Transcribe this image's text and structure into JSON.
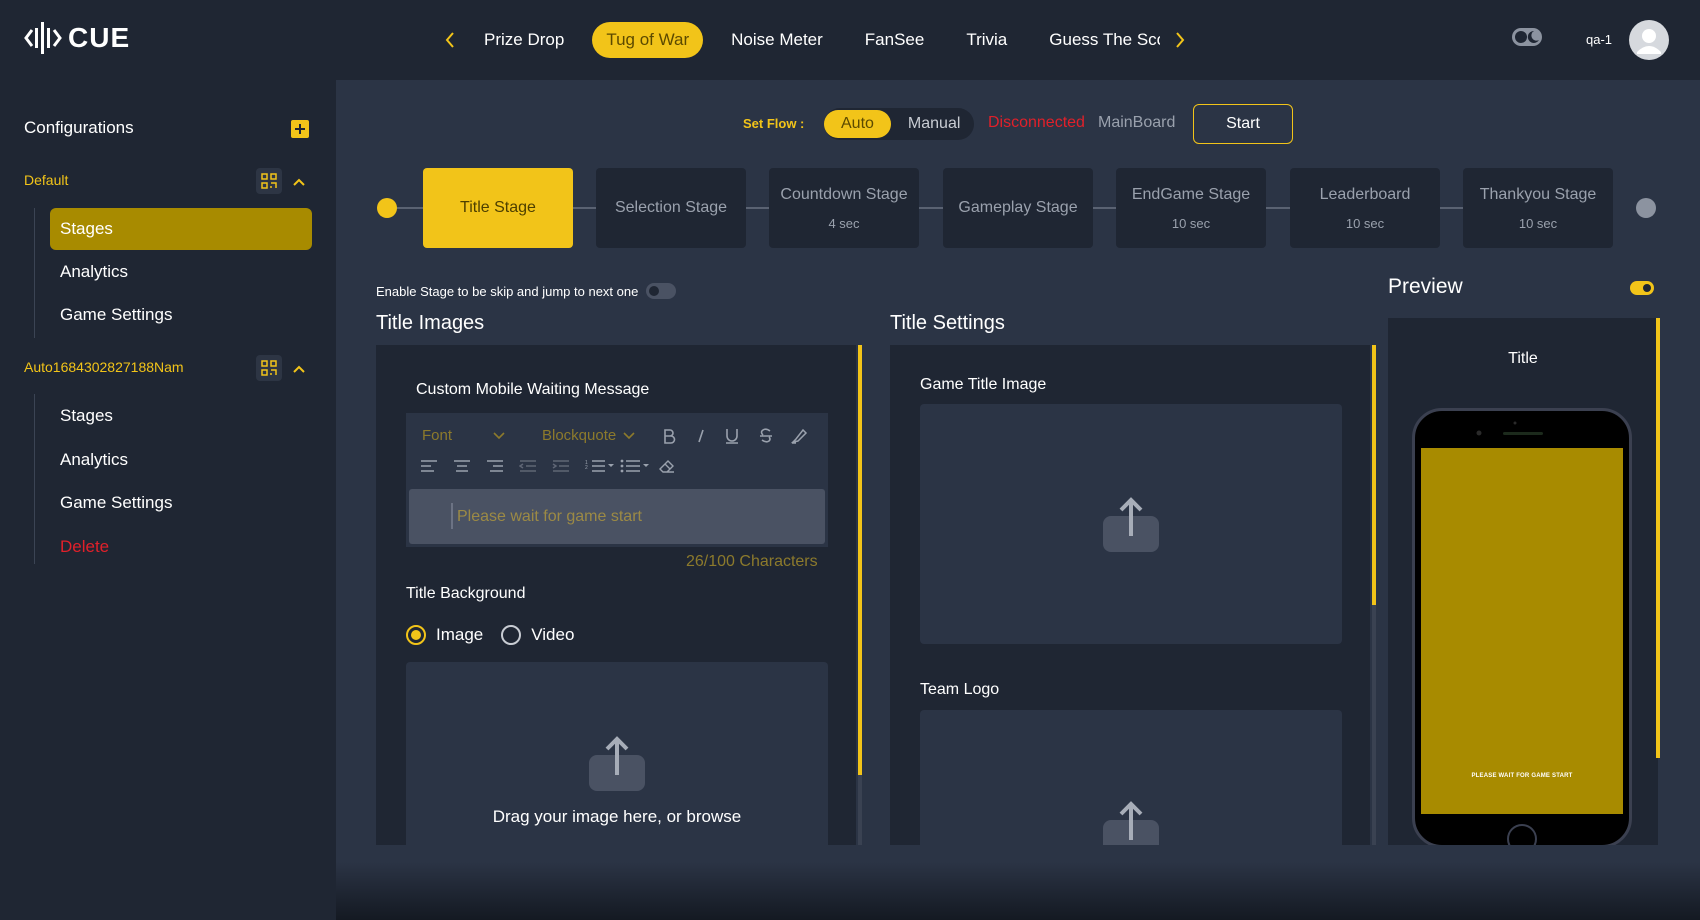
{
  "app": {
    "logo_text": "CUE",
    "user_name": "qa-1"
  },
  "nav": {
    "tabs": [
      {
        "label": "Prize Drop",
        "active": false
      },
      {
        "label": "Tug of War",
        "active": true
      },
      {
        "label": "Noise Meter",
        "active": false
      },
      {
        "label": "FanSee",
        "active": false
      },
      {
        "label": "Trivia",
        "active": false
      },
      {
        "label": "Guess The Sco",
        "active": false
      }
    ]
  },
  "sidebar": {
    "title": "Configurations",
    "groups": [
      {
        "label": "Default",
        "items": [
          "Stages",
          "Analytics",
          "Game Settings"
        ],
        "active_item": "Stages"
      },
      {
        "label": "Auto1684302827188Nam",
        "items": [
          "Stages",
          "Analytics",
          "Game Settings",
          "Delete"
        ]
      }
    ]
  },
  "flow": {
    "label": "Set Flow :",
    "options": [
      "Auto",
      "Manual"
    ],
    "selected": "Auto",
    "status": "Disconnected",
    "board": "MainBoard",
    "start_label": "Start"
  },
  "stages": [
    {
      "name": "Title Stage",
      "duration": "",
      "active": true
    },
    {
      "name": "Selection Stage",
      "duration": ""
    },
    {
      "name": "Countdown Stage",
      "duration": "4 sec"
    },
    {
      "name": "Gameplay Stage",
      "duration": ""
    },
    {
      "name": "EndGame Stage",
      "duration": "10 sec"
    },
    {
      "name": "Leaderboard",
      "duration": "10 sec"
    },
    {
      "name": "Thankyou Stage",
      "duration": "10 sec"
    }
  ],
  "skip_toggle_label": "Enable Stage to be skip and jump to next one",
  "title_images": {
    "heading": "Title Images",
    "message_label": "Custom Mobile Waiting Message",
    "font_placeholder": "Font",
    "block_placeholder": "Blockquote",
    "message_value": "Please wait for game start",
    "char_count": "26/100 Characters",
    "background_label": "Title Background",
    "bg_options": [
      "Image",
      "Video"
    ],
    "bg_selected": "Image",
    "drop_text": "Drag your image here, or browse"
  },
  "title_settings": {
    "heading": "Title Settings",
    "game_title_image_label": "Game Title Image",
    "team_logo_label": "Team Logo"
  },
  "preview": {
    "heading": "Preview",
    "screen_label": "Title",
    "phone_message": "PLEASE WAIT FOR GAME START"
  },
  "colors": {
    "accent": "#f2c419",
    "accent_dark": "#a88b00",
    "danger": "#e0202a",
    "bg": "#1f2633",
    "panel": "#2b3445"
  }
}
